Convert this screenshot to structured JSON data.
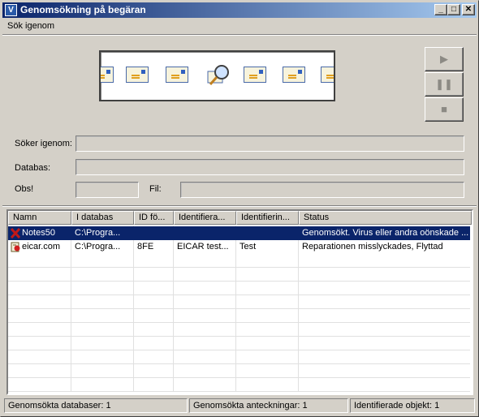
{
  "window": {
    "title": "Genomsökning på begäran",
    "app_icon": "v-icon",
    "min_label": "_",
    "max_label": "□",
    "close_label": "✕"
  },
  "menu": {
    "items": [
      "Sök igenom"
    ]
  },
  "controls": {
    "play": "▶",
    "pause": "❚❚",
    "stop": "■"
  },
  "fields": {
    "scanning_label": "Söker igenom:",
    "scanning_value": "",
    "database_label": "Databas:",
    "database_value": "",
    "note_label": "Obs!",
    "note_value": "",
    "file_label": "Fil:",
    "file_value": ""
  },
  "table": {
    "columns": [
      "Namn",
      "I databas",
      "ID fö...",
      "Identifiera...",
      "Identifierin...",
      "Status"
    ],
    "rows": [
      {
        "icon": "red-x-icon",
        "name": "Notes50",
        "database": "C:\\Progra...",
        "id": "",
        "identified": "",
        "identification": "",
        "status": "Genomsökt. Virus eller andra oönskade ...",
        "selected": true
      },
      {
        "icon": "infected-file-icon",
        "name": "eicar.com",
        "database": "C:\\Progra...",
        "id": "8FE",
        "identified": "EICAR test...",
        "identification": "Test",
        "status": "Reparationen misslyckades, Flyttad",
        "selected": false
      }
    ]
  },
  "statusbar": {
    "databases": "Genomsökta databaser: 1",
    "notes": "Genomsökta anteckningar: 1",
    "identified": "Identifierade objekt: 1"
  },
  "colors": {
    "titlebar_start": "#0a246a",
    "titlebar_end": "#a6caf0",
    "selection": "#0a246a",
    "face": "#d4d0c8"
  }
}
